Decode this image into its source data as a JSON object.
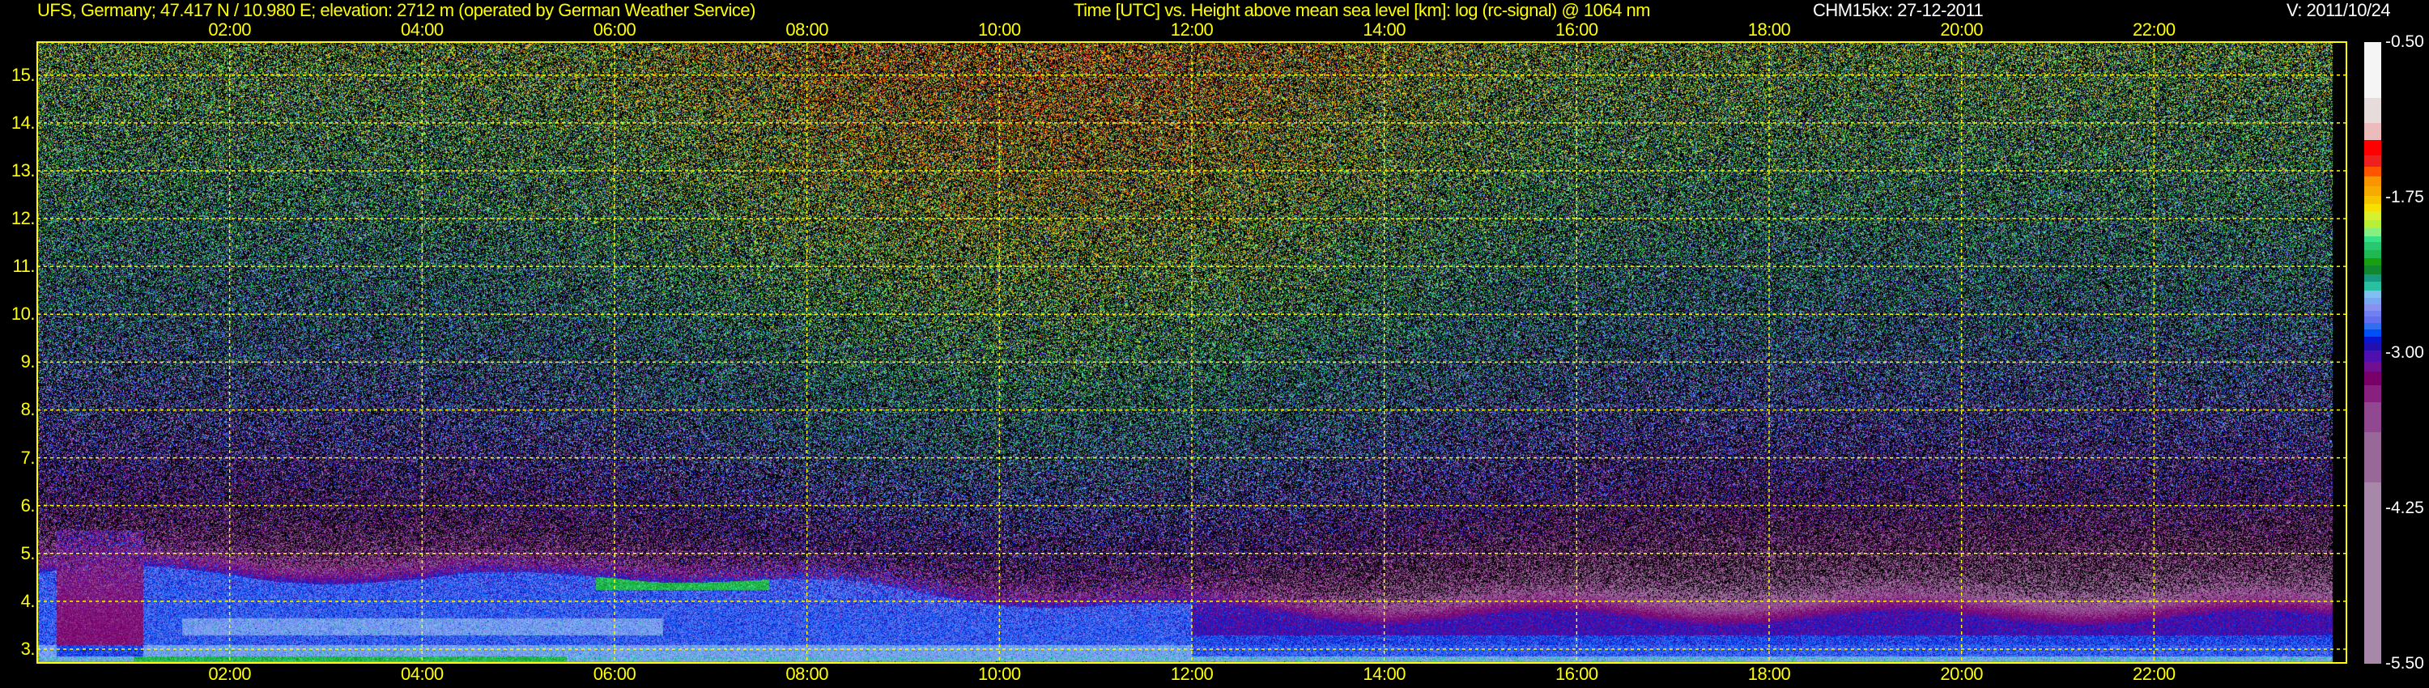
{
  "header": {
    "title": "UFS, Germany; 47.417 N / 10.980 E; elevation: 2712 m  (operated by German Weather Service)",
    "chart_title": "Time [UTC] vs. Height above mean sea level [km]: log (rc-signal) @ 1064 nm",
    "instrument": "CHM15kx: 27-12-2011",
    "version": "V: 2011/10/24"
  },
  "colors": {
    "axis": "#ffff00",
    "grid": "#ffff00",
    "background": "#000000",
    "text_white": "#ffffff"
  },
  "chart_data": {
    "type": "heatmap",
    "title": "Time [UTC] vs. Height above mean sea level [km]: log (rc-signal) @ 1064 nm",
    "xlabel": "Time [UTC]",
    "ylabel": "Height above mean sea level [km]",
    "xlim": [
      0,
      24
    ],
    "ylim": [
      2.712,
      15.69
    ],
    "x_ticks": [
      2,
      4,
      6,
      8,
      10,
      12,
      14,
      16,
      18,
      20,
      22
    ],
    "x_tick_labels": [
      "02:00",
      "04:00",
      "06:00",
      "08:00",
      "10:00",
      "12:00",
      "14:00",
      "16:00",
      "18:00",
      "20:00",
      "22:00"
    ],
    "y_ticks": [
      3,
      4,
      5,
      6,
      7,
      8,
      9,
      10,
      11,
      12,
      13,
      14,
      15
    ],
    "y_tick_labels": [
      "3.",
      "4.",
      "5.",
      "6.",
      "7.",
      "8.",
      "9.",
      "10.",
      "11.",
      "12.",
      "13.",
      "14.",
      "15."
    ],
    "grid": true,
    "data_end_hour": 23.85,
    "layer_top_km": {
      "t": [
        0,
        2,
        4,
        6,
        7,
        9,
        12,
        14,
        18,
        24
      ],
      "h": [
        4.6,
        4.6,
        4.4,
        4.6,
        4.5,
        4.2,
        3.8,
        3.6,
        3.6,
        3.6
      ]
    },
    "colorbar": {
      "label": "log (rc-signal)",
      "min": -5.5,
      "max": -0.5,
      "ticks": [
        -0.5,
        -1.75,
        -3.0,
        -4.25,
        -5.5
      ],
      "tick_labels": [
        "-0.50",
        "-1.75",
        "-3.00",
        "-4.25",
        "-5.50"
      ],
      "bounds": [
        -0.5,
        -0.95,
        -1.15,
        -1.29,
        -1.41,
        -1.5,
        -1.58,
        -1.66,
        -1.74,
        -1.8,
        -1.86,
        -1.93,
        -2.0,
        -2.06,
        -2.11,
        -2.17,
        -2.24,
        -2.3,
        -2.37,
        -2.43,
        -2.5,
        -2.56,
        -2.61,
        -2.66,
        -2.71,
        -2.76,
        -2.81,
        -2.87,
        -2.92,
        -2.98,
        -3.07,
        -3.15,
        -3.26,
        -3.4,
        -3.64,
        -4.04,
        -5.5
      ],
      "colors": [
        "#f5f5f5",
        "#e6dcdc",
        "#ecbcbc",
        "#ff0000",
        "#ee2020",
        "#ff5500",
        "#f99500",
        "#f7aa00",
        "#f8c400",
        "#f8e000",
        "#d8f030",
        "#b8f038",
        "#88f080",
        "#38e088",
        "#28c870",
        "#20b850",
        "#18a010",
        "#108830",
        "#189880",
        "#28c0a0",
        "#80c0f0",
        "#78a8f0",
        "#8890f0",
        "#7080f0",
        "#6070f0",
        "#3070f0",
        "#0050f8",
        "#0818d0",
        "#2010b0",
        "#5010b0",
        "#701090",
        "#780068",
        "#882080",
        "#904890",
        "#986898",
        "#a888a8"
      ]
    }
  }
}
